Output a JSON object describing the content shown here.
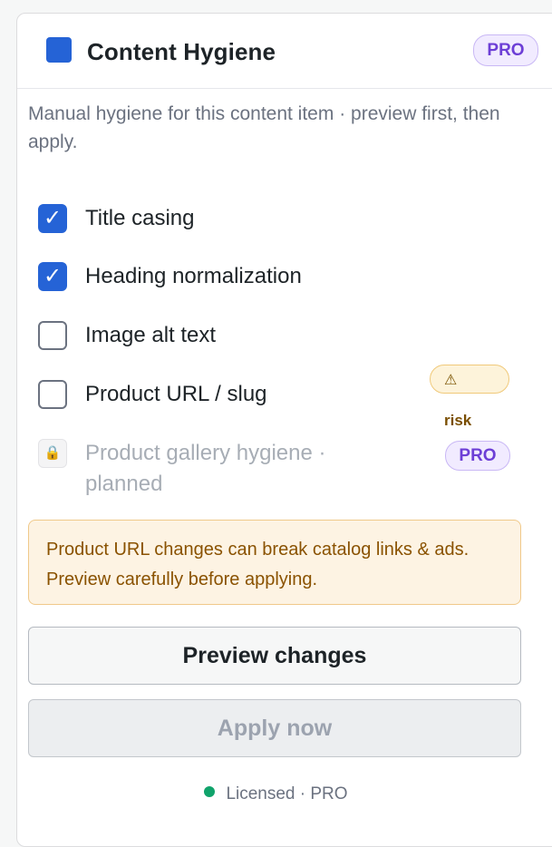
{
  "panel": {
    "title": "Content Hygiene",
    "badge": "PRO",
    "description": "Manual hygiene for this content item · preview first, then apply."
  },
  "options": [
    {
      "label": "Title casing",
      "checked": true
    },
    {
      "label": "Heading normalization",
      "checked": true
    },
    {
      "label": "Image alt text",
      "checked": false
    },
    {
      "label": "Product URL / slug",
      "checked": false,
      "risk": "risk"
    }
  ],
  "risk_icon": "warning-icon",
  "planned": {
    "label": "Product gallery hygiene · planned",
    "badge": "PRO",
    "icon": "lock-icon"
  },
  "notice": "Product URL changes can break catalog links & ads. Preview carefully before applying.",
  "buttons": {
    "preview": "Preview changes",
    "apply": "Apply now"
  },
  "footer": {
    "status": "Licensed · PRO"
  },
  "colors": {
    "accent": "#2563d6",
    "pro_badge": "#6d3fd6",
    "risk": "#7a4e00",
    "license_dot": "#10a36b"
  }
}
